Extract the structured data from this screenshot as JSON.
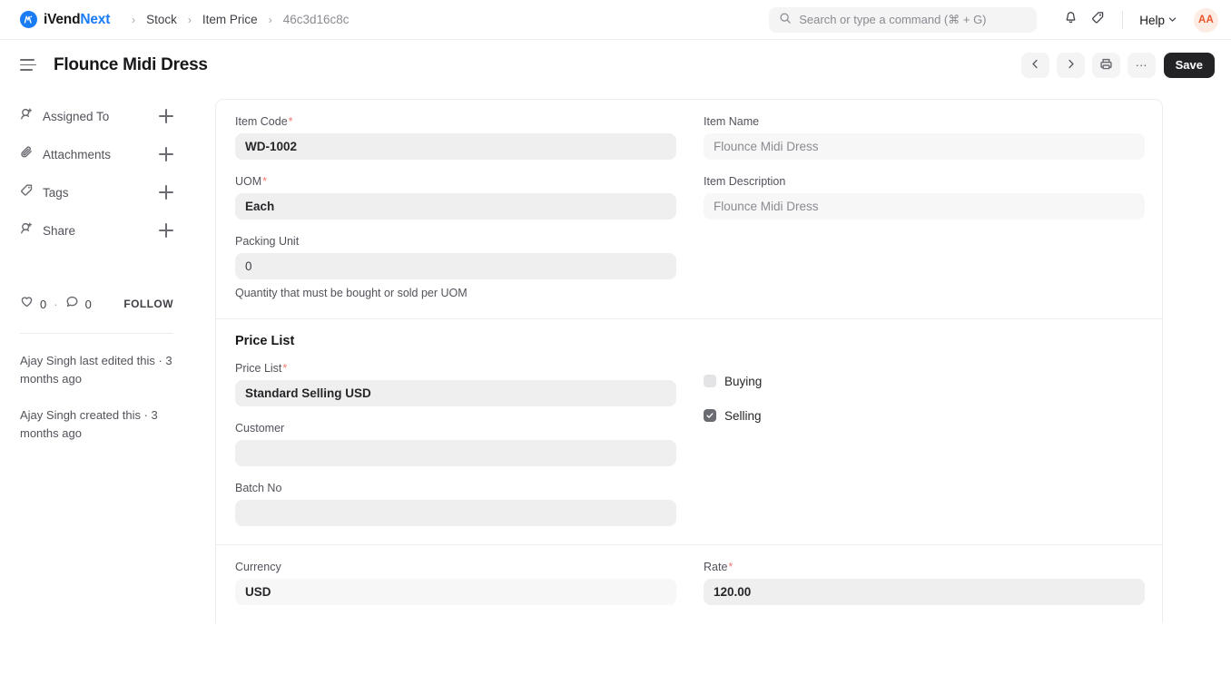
{
  "navbar": {
    "brand_prefix": "iVend",
    "brand_suffix": "Next",
    "breadcrumbs": [
      {
        "label": "Stock",
        "muted": false
      },
      {
        "label": "Item Price",
        "muted": false
      },
      {
        "label": "46c3d16c8c",
        "muted": true
      }
    ],
    "separator": "›",
    "search_placeholder": "Search or type a command (⌘ + G)",
    "notifications_icon": "bell-icon",
    "tags_icon": "tag-icon",
    "help_label": "Help",
    "avatar_initials": "AA",
    "avatar_bg": "#fdece3",
    "avatar_color": "#e8562a",
    "accent_color": "#1a7cf5"
  },
  "pagehead": {
    "menu_icon": "hamburger-icon",
    "title": "Flounce Midi Dress",
    "prev_label": "‹",
    "next_label": "›",
    "print_icon": "printer-icon",
    "more_label": "···",
    "save_label": "Save",
    "save_bg": "#232326"
  },
  "sidebar": {
    "items": [
      {
        "label": "Assigned To",
        "icon": "user-plus-icon",
        "add_label": "+"
      },
      {
        "label": "Attachments",
        "icon": "paperclip-icon",
        "add_label": "+"
      },
      {
        "label": "Tags",
        "icon": "tag-icon",
        "add_label": "+"
      },
      {
        "label": "Share",
        "icon": "user-share-icon",
        "add_label": "+"
      }
    ],
    "like_count": "0",
    "comment_count": "0",
    "separator_dot": "·",
    "follow_label": "FOLLOW",
    "activity": [
      "Ajay Singh last edited this · 3 months ago",
      "Ajay Singh created this · 3 months ago"
    ]
  },
  "form": {
    "sections": [
      {
        "title": "",
        "left": [
          {
            "label": "Item Code",
            "required": true,
            "value": "WD-1002",
            "style": "bold"
          },
          {
            "label": "UOM",
            "required": true,
            "value": "Each",
            "style": "bold"
          },
          {
            "label": "Packing Unit",
            "required": false,
            "value": "0",
            "style": "plain",
            "help": "Quantity that must be bought or sold per UOM"
          }
        ],
        "right": [
          {
            "label": "Item Name",
            "required": false,
            "value": "Flounce Midi Dress",
            "style": "readonly"
          },
          {
            "label": "Item Description",
            "required": false,
            "value": "Flounce Midi Dress",
            "style": "readonly"
          }
        ]
      },
      {
        "title": "Price List",
        "left": [
          {
            "label": "Price List",
            "required": true,
            "value": "Standard Selling USD",
            "style": "bold"
          },
          {
            "label": "Customer",
            "required": false,
            "value": "",
            "style": "bold"
          },
          {
            "label": "Batch No",
            "required": false,
            "value": "",
            "style": "bold"
          }
        ],
        "checkboxes": [
          {
            "label": "Buying",
            "checked": false
          },
          {
            "label": "Selling",
            "checked": true
          }
        ]
      },
      {
        "title": "",
        "left": [
          {
            "label": "Currency",
            "required": false,
            "value": "USD",
            "style": "bold"
          }
        ],
        "right": [
          {
            "label": "Rate",
            "required": true,
            "value": "120.00",
            "style": "bold"
          }
        ]
      }
    ]
  }
}
